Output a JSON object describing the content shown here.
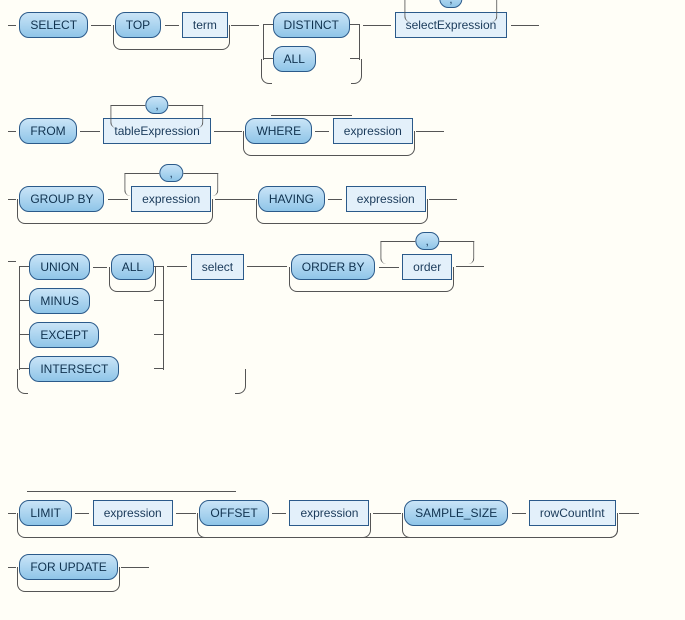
{
  "kw": {
    "select": "SELECT",
    "top": "TOP",
    "distinct": "DISTINCT",
    "all": "ALL",
    "from": "FROM",
    "where": "WHERE",
    "group_by": "GROUP BY",
    "having": "HAVING",
    "union": "UNION",
    "minus": "MINUS",
    "except": "EXCEPT",
    "intersect": "INTERSECT",
    "order_by": "ORDER BY",
    "limit": "LIMIT",
    "offset": "OFFSET",
    "sample_size": "SAMPLE_SIZE",
    "for_update": "FOR UPDATE",
    "comma": ","
  },
  "ref": {
    "term": "term",
    "select_expression": "selectExpression",
    "table_expression": "tableExpression",
    "expression": "expression",
    "select": "select",
    "order": "order",
    "row_count_int": "rowCountInt"
  },
  "chart_data": {
    "type": "railroad",
    "grammar": "SELECT [ TOP term ] [ DISTINCT | ALL ] selectExpression { , selectExpression } FROM tableExpression { , tableExpression } [ WHERE expression ] [ GROUP BY expression { , expression } ] [ HAVING expression ] [ ( UNION [ ALL ] | MINUS | EXCEPT | INTERSECT ) select ] [ ORDER BY order { , order } ] [ LIMIT expression [ OFFSET expression ] [ SAMPLE_SIZE rowCountInt ] ] [ FOR UPDATE ]",
    "keywords": [
      "SELECT",
      "TOP",
      "DISTINCT",
      "ALL",
      "FROM",
      "WHERE",
      "GROUP BY",
      "HAVING",
      "UNION",
      "MINUS",
      "EXCEPT",
      "INTERSECT",
      "ORDER BY",
      "LIMIT",
      "OFFSET",
      "SAMPLE_SIZE",
      "FOR UPDATE"
    ],
    "nonterminals": [
      "term",
      "selectExpression",
      "tableExpression",
      "expression",
      "select",
      "order",
      "rowCountInt"
    ]
  }
}
